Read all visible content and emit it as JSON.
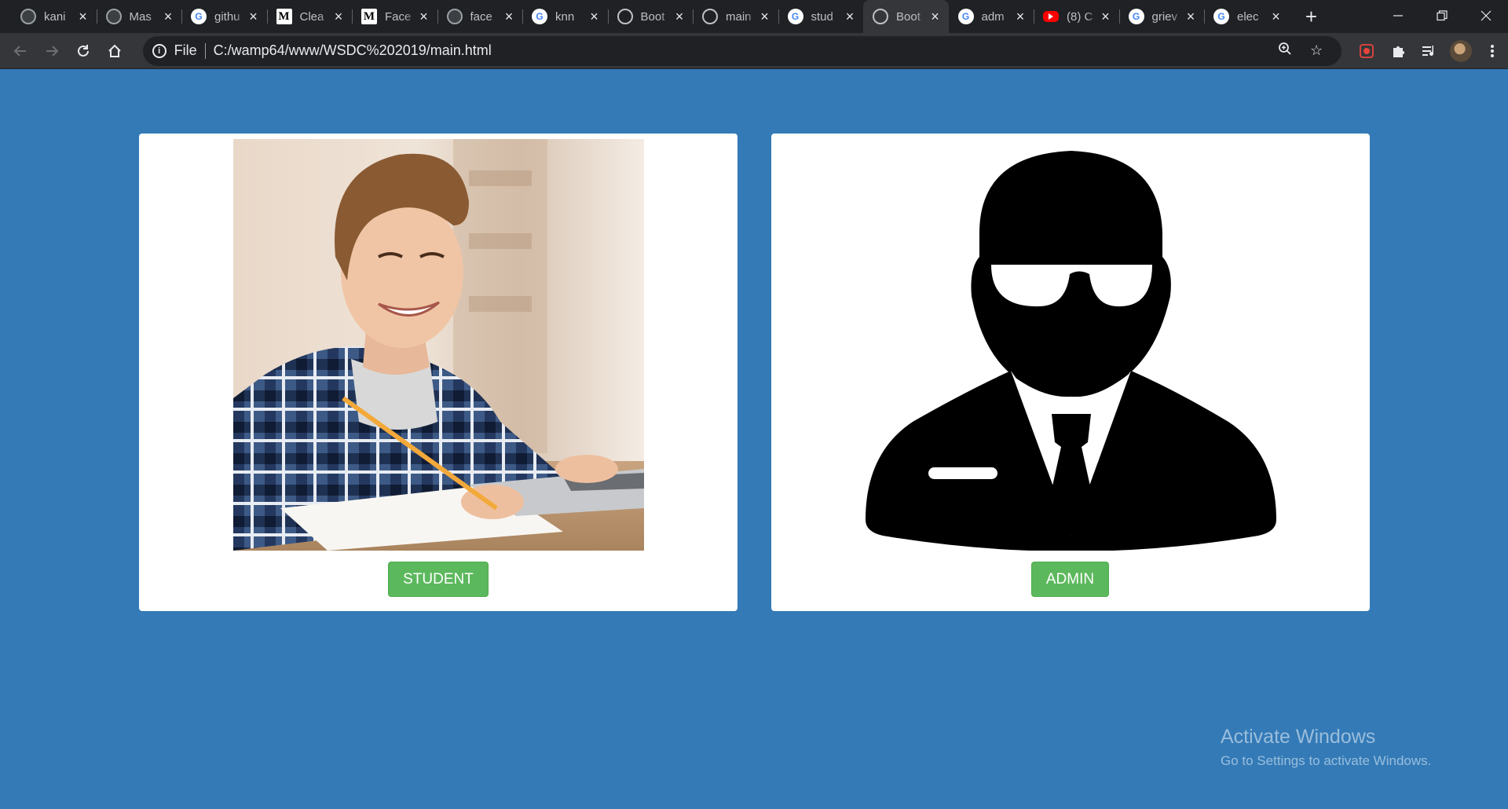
{
  "browser": {
    "tabs": [
      {
        "title": "kani",
        "favicon": "github-icon"
      },
      {
        "title": "Mas",
        "favicon": "github-icon"
      },
      {
        "title": "githu",
        "favicon": "google-icon"
      },
      {
        "title": "Clea",
        "favicon": "medium-icon"
      },
      {
        "title": "Face",
        "favicon": "medium-icon"
      },
      {
        "title": "face",
        "favicon": "github-icon"
      },
      {
        "title": "knn",
        "favicon": "google-icon"
      },
      {
        "title": "Boot",
        "favicon": "globe-icon"
      },
      {
        "title": "main",
        "favicon": "globe-icon"
      },
      {
        "title": "stud",
        "favicon": "google-icon"
      },
      {
        "title": "Boot",
        "favicon": "globe-icon",
        "active": true
      },
      {
        "title": "adm",
        "favicon": "google-icon"
      },
      {
        "title": "(8) C",
        "favicon": "youtube-icon"
      },
      {
        "title": "griev",
        "favicon": "google-icon"
      },
      {
        "title": "elec",
        "favicon": "google-icon"
      }
    ],
    "address": {
      "scheme": "File",
      "url": "C:/wamp64/www/WSDC%202019/main.html"
    }
  },
  "page": {
    "student_button": "STUDENT",
    "admin_button": "ADMIN",
    "background_color": "#337ab7",
    "button_color": "#5cb85c"
  },
  "watermark": {
    "title": "Activate Windows",
    "subtitle": "Go to Settings to activate Windows."
  }
}
